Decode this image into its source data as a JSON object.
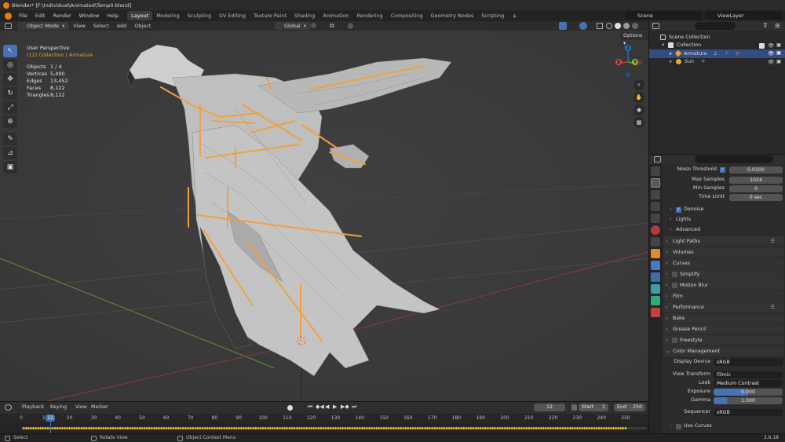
{
  "window": {
    "title": "Blender* [F:\\Individual\\Animated\\Temp0.blend]"
  },
  "menus": [
    "File",
    "Edit",
    "Render",
    "Window",
    "Help"
  ],
  "workspaces": [
    "Layout",
    "Modeling",
    "Sculpting",
    "UV Editing",
    "Texture Paint",
    "Shading",
    "Animation",
    "Rendering",
    "Compositing",
    "Geometry Nodes",
    "Scripting"
  ],
  "active_workspace": "Layout",
  "scene": "Scene",
  "view_layer": "ViewLayer",
  "viewport_header": {
    "mode": "Object Mode",
    "menus": [
      "View",
      "Select",
      "Add",
      "Object"
    ],
    "transform_orientation": "Global",
    "options": "Options"
  },
  "viewport_overlay": {
    "view_name": "User Perspective",
    "collection_line": "(12) Collection | Armature",
    "stats": [
      {
        "label": "Objects",
        "value": "1 / 4"
      },
      {
        "label": "Vertices",
        "value": "5,490"
      },
      {
        "label": "Edges",
        "value": "13,452"
      },
      {
        "label": "Faces",
        "value": "8,122"
      },
      {
        "label": "Triangles",
        "value": "8,122"
      }
    ]
  },
  "gizmo": {
    "x": "X",
    "y": "Y",
    "z": "Z"
  },
  "outliner": {
    "root": "Scene Collection",
    "items": [
      {
        "name": "Collection",
        "depth": 1,
        "selected": false
      },
      {
        "name": "Armature",
        "depth": 2,
        "selected": true
      },
      {
        "name": "Sun",
        "depth": 2,
        "selected": false
      }
    ]
  },
  "properties": {
    "noise_threshold": {
      "label": "Noise Threshold",
      "value": "0.0100"
    },
    "max_samples": {
      "label": "Max Samples",
      "value": "1024"
    },
    "min_samples": {
      "label": "Min Samples",
      "value": "0"
    },
    "time_limit": {
      "label": "Time Limit",
      "value": "0 sec"
    },
    "subsections": [
      "Denoise",
      "Lights",
      "Advanced"
    ],
    "sections": [
      "Light Paths",
      "Volumes",
      "Curves",
      "Simplify",
      "Motion Blur",
      "Film",
      "Performance",
      "Bake",
      "Grease Pencil",
      "Freestyle",
      "Color Management"
    ],
    "color_management": {
      "display_device": {
        "label": "Display Device",
        "value": "sRGB"
      },
      "view_transform": {
        "label": "View Transform",
        "value": "Filmic"
      },
      "look": {
        "label": "Look",
        "value": "Medium Contrast"
      },
      "exposure": {
        "label": "Exposure",
        "value": "0.000"
      },
      "gamma": {
        "label": "Gamma",
        "value": "1.000"
      },
      "sequencer": {
        "label": "Sequencer",
        "value": "sRGB"
      },
      "use_curves": "Use Curves"
    }
  },
  "timeline": {
    "menus": [
      "Playback",
      "Keying",
      "View",
      "Marker"
    ],
    "current_frame": "12",
    "start_label": "Start",
    "start": "1",
    "end_label": "End",
    "end": "250",
    "ruler": [
      "0",
      "10",
      "20",
      "30",
      "40",
      "50",
      "60",
      "70",
      "80",
      "90",
      "100",
      "110",
      "120",
      "130",
      "140",
      "150",
      "160",
      "170",
      "180",
      "190",
      "200",
      "210",
      "220",
      "230",
      "240",
      "250"
    ]
  },
  "status_bar": {
    "select": "Select",
    "rotate": "Rotate View",
    "context": "Object Context Menu",
    "version": "3.6.18"
  },
  "colors": {
    "accent": "#4772b3",
    "bone": "#f0a040",
    "selected_row": "#334d80"
  }
}
